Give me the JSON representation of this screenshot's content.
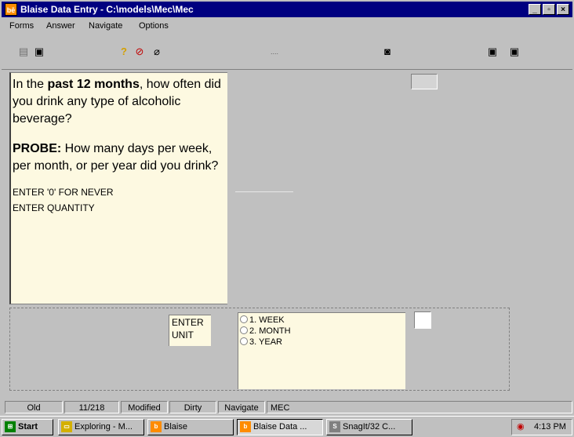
{
  "window": {
    "title": "Blaise Data Entry - C:\\models\\Mec\\Mec",
    "app_icon_text": "bē"
  },
  "menu": [
    {
      "label": "Forms"
    },
    {
      "label": "Answer"
    },
    {
      "label": "Navigate"
    },
    {
      "label": "Options"
    }
  ],
  "toolbar": {
    "dots": "...."
  },
  "question": {
    "line1_pre": "In the ",
    "line1_bold": "past 12 months",
    "line1_post": ", how often did you drink any type of alcoholic beverage?",
    "probe_label": "PROBE:",
    "probe_text": " How many days per week, per month, or per year did you drink?",
    "instruction1": "ENTER '0' FOR NEVER",
    "instruction2": "ENTER QUANTITY"
  },
  "unit_question": {
    "text_line1": "ENTER",
    "text_line2": "UNIT",
    "options": [
      "1. WEEK",
      "2. MONTH",
      "3. YEAR"
    ]
  },
  "status": {
    "mode": "Old",
    "position": "11/218",
    "modified": "Modified",
    "dirty": "Dirty",
    "navigate": "Navigate",
    "block": "MEC"
  },
  "taskbar": {
    "start": "Start",
    "items": [
      {
        "label": "Exploring - M..."
      },
      {
        "label": "Blaise"
      },
      {
        "label": "Blaise Data ..."
      },
      {
        "label": "SnagIt/32 C..."
      }
    ],
    "clock": "4:13 PM"
  },
  "colors": {
    "titlebar": "#000080",
    "panel": "#fdf9e1",
    "chrome": "#c0c0c0"
  }
}
